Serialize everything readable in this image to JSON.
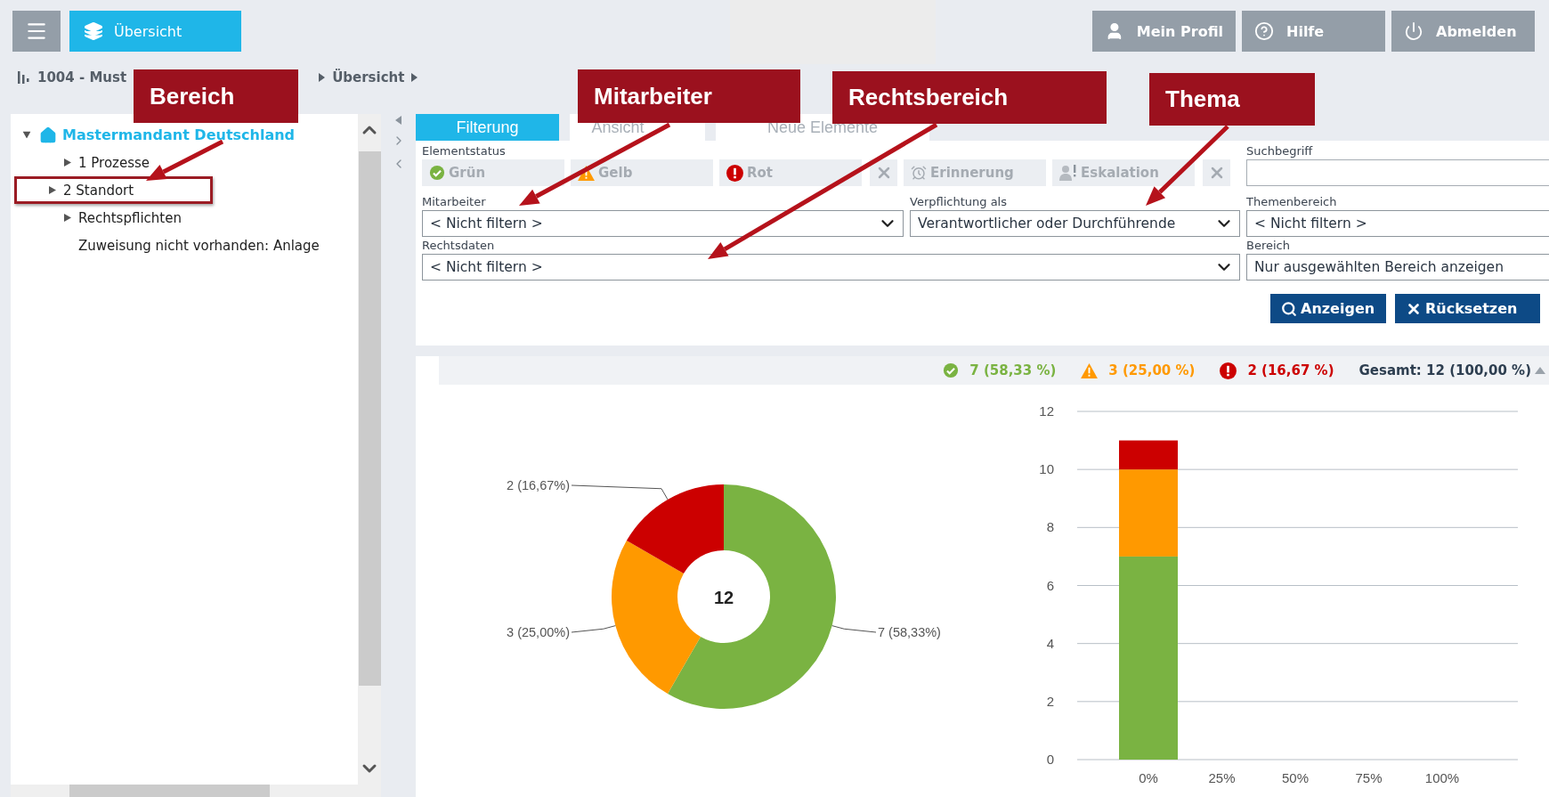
{
  "topbar": {
    "menu_button": {
      "kind": "menu"
    },
    "home_button": {
      "label": "Übersicht"
    },
    "user_buttons": [
      {
        "kind": "profile",
        "label": "Mein Profil"
      },
      {
        "kind": "help",
        "label": "Hilfe"
      },
      {
        "kind": "logout",
        "label": "Abmelden"
      }
    ]
  },
  "breadcrumb": [
    "1004 - Must",
    "Übersicht"
  ],
  "tree": {
    "label": "Mastermandant Deutschland",
    "expanded": true,
    "children": [
      {
        "label": "1 Prozesse",
        "kind": "folder",
        "expanded": false,
        "highlighted": false
      },
      {
        "label": "2 Standort",
        "kind": "folder",
        "expanded": false,
        "highlighted": true
      },
      {
        "label": "Rechtspflichten",
        "kind": "folder",
        "expanded": false,
        "highlighted": false
      },
      {
        "label": "Zuweisung nicht vorhanden: Anlage",
        "kind": "leaf",
        "highlighted": false
      }
    ]
  },
  "tabs": [
    {
      "label": "Filterung",
      "selected": true
    },
    {
      "label": "Ansicht",
      "selected": false
    },
    {
      "label": "Neue Elemente",
      "selected": false
    }
  ],
  "filter": {
    "status_label": "Elementstatus",
    "status_buttons": [
      {
        "kind": "ok",
        "label": "Grün",
        "selected": false
      },
      {
        "kind": "warn",
        "label": "Gelb",
        "selected": false
      },
      {
        "kind": "error",
        "label": "Rot",
        "selected": false
      },
      {
        "kind": "clear"
      },
      {
        "kind": "alarm",
        "label": "Erinnerung",
        "selected": false
      },
      {
        "kind": "escalation",
        "label": "Eskalation",
        "selected": false
      },
      {
        "kind": "clear"
      }
    ],
    "search": {
      "label": "Suchbegriff"
    },
    "selects": [
      {
        "label": "Mitarbeiter",
        "value": "< Nicht filtern >"
      },
      {
        "label": "Verpflichtung als",
        "value": "Verantwortlicher oder Durchführende"
      },
      {
        "label": "Themenbereich",
        "value": "< Nicht filtern >"
      },
      {
        "label": "Rechtsdaten",
        "value": "< Nicht filtern >"
      },
      {
        "label": "Bereich",
        "value": "Nur ausgewählten Bereich anzeigen"
      }
    ],
    "actions": [
      {
        "kind": "search",
        "label": "Anzeigen"
      },
      {
        "kind": "reset",
        "label": "Rücksetzen"
      }
    ]
  },
  "summary": [
    {
      "kind": "ok",
      "text": "7 (58,33 %)",
      "color": "#7ab342"
    },
    {
      "kind": "warn",
      "text": "3 (25,00 %)",
      "color": "#ff9900"
    },
    {
      "kind": "error",
      "text": "2 (16,67 %)",
      "color": "#cc0000"
    },
    {
      "kind": "total",
      "text": "Gesamt: 12 (100,00 %)",
      "color": "#2d3e50"
    }
  ],
  "donut": {
    "chart_data": {
      "type": "donut",
      "values": [
        7,
        3,
        2
      ],
      "colors": [
        "#7ab342",
        "#ff9900",
        "#cc0000"
      ],
      "value_labels": [
        "7 (58,33%)",
        "3 (25,00%)",
        "2 (16,67%)"
      ],
      "annotations": [
        "12"
      ]
    }
  },
  "bar": {
    "chart_data": {
      "type": "bar",
      "stacked": true,
      "categories": [
        "0%",
        "25%",
        "50%",
        "75%",
        "100%"
      ],
      "series": [
        {
          "color": "#7ab342",
          "values": [
            7,
            null,
            null,
            null,
            null
          ]
        },
        {
          "color": "#ff9900",
          "values": [
            3,
            null,
            null,
            null,
            null
          ]
        },
        {
          "color": "#cc0000",
          "values": [
            1,
            null,
            null,
            null,
            null
          ]
        }
      ],
      "ylim": [
        0,
        12
      ],
      "yticks": [
        0,
        2,
        4,
        6,
        8,
        10,
        12
      ],
      "grid": true
    }
  },
  "callouts": [
    {
      "label": "Bereich"
    },
    {
      "label": "Mitarbeiter"
    },
    {
      "label": "Rechtsbereich"
    },
    {
      "label": "Thema"
    }
  ]
}
